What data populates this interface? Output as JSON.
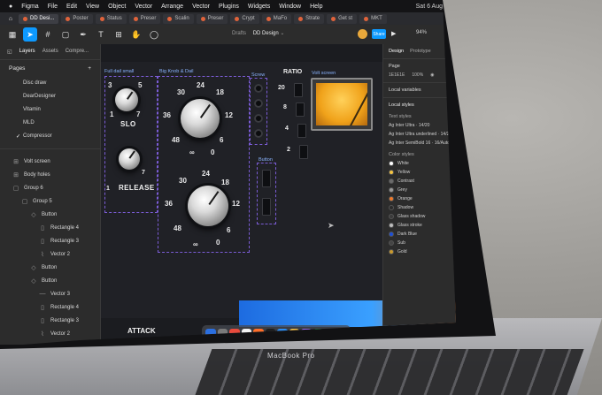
{
  "mac_menu": {
    "items": [
      "Figma",
      "File",
      "Edit",
      "View",
      "Object",
      "Vector",
      "Arrange",
      "Vector",
      "Plugins",
      "Widgets",
      "Window",
      "Help"
    ],
    "status": "Sat 6 Aug"
  },
  "tabs": [
    {
      "label": "DD Desi...",
      "active": true
    },
    {
      "label": "Poster",
      "active": false
    },
    {
      "label": "Status",
      "active": false
    },
    {
      "label": "Preser",
      "active": false
    },
    {
      "label": "Scalin",
      "active": false
    },
    {
      "label": "Preser",
      "active": false
    },
    {
      "label": "Crypt",
      "active": false
    },
    {
      "label": "MaFo",
      "active": false
    },
    {
      "label": "Strate",
      "active": false
    },
    {
      "label": "Get st",
      "active": false
    },
    {
      "label": "MKT",
      "active": false
    }
  ],
  "toolbar": {
    "breadcrumb_prefix": "Drafts",
    "file_name": "DD Design",
    "share_label": "Share",
    "zoom": "94%"
  },
  "left_panel": {
    "tabs": [
      "Layers",
      "Assets",
      "Compre..."
    ],
    "pages_header": "Pages",
    "add_label": "+",
    "pages": [
      {
        "label": "Disc draw",
        "current": false
      },
      {
        "label": "DearDesigner",
        "current": false
      },
      {
        "label": "Vitamin",
        "current": false
      },
      {
        "label": "MLD",
        "current": false
      },
      {
        "label": "Compressor",
        "current": true
      }
    ],
    "layers": [
      {
        "label": "Volt screen",
        "glyph": "⊞",
        "indent": 0
      },
      {
        "label": "Body holes",
        "glyph": "⊞",
        "indent": 0
      },
      {
        "label": "Group 6",
        "glyph": "▢",
        "indent": 0
      },
      {
        "label": "Group 5",
        "glyph": "▢",
        "indent": 1
      },
      {
        "label": "Button",
        "glyph": "◇",
        "indent": 2
      },
      {
        "label": "Rectangle 4",
        "glyph": "▯",
        "indent": 3
      },
      {
        "label": "Rectangle 3",
        "glyph": "▯",
        "indent": 3
      },
      {
        "label": "Vector 2",
        "glyph": "⌇",
        "indent": 3
      },
      {
        "label": "Button",
        "glyph": "◇",
        "indent": 2
      },
      {
        "label": "Button",
        "glyph": "◇",
        "indent": 2
      },
      {
        "label": "Vector 3",
        "glyph": "—",
        "indent": 3
      },
      {
        "label": "Rectangle 4",
        "glyph": "▯",
        "indent": 3
      },
      {
        "label": "Rectangle 3",
        "glyph": "▯",
        "indent": 3
      },
      {
        "label": "Vector 2",
        "glyph": "⌇",
        "indent": 3
      },
      {
        "label": "Button",
        "glyph": "◇",
        "indent": 2
      }
    ]
  },
  "canvas": {
    "frame_labels": {
      "full_dial_small": "Full dail small",
      "big_knob": "Big Knob & Dail",
      "screw": "Screw",
      "volt_screen": "Volt screen",
      "button": "Button"
    },
    "slo": {
      "label": "SLO",
      "ticks": [
        "3",
        "5",
        "1",
        "7"
      ]
    },
    "release": {
      "label": "RELEASE",
      "ticks": [
        "3",
        "5",
        "1",
        "7"
      ]
    },
    "big_knob_1": {
      "ticks": [
        "30",
        "24",
        "18",
        "12",
        "36",
        "48",
        "6",
        "0",
        "∞"
      ]
    },
    "big_knob_2": {
      "ticks": [
        "30",
        "24",
        "18",
        "12",
        "36",
        "48",
        "6",
        "0",
        "∞"
      ]
    },
    "ratio": {
      "title": "RATIO",
      "values": [
        "20",
        "8",
        "4",
        "2"
      ]
    },
    "attack_label": "ATTACK"
  },
  "right_panel": {
    "tabs": [
      "Design",
      "Prototype"
    ],
    "page_label": "Page",
    "page_color": "1E1E1E",
    "page_opacity": "100%",
    "local_variables": "Local variables",
    "local_styles": "Local styles",
    "text_styles_header": "Text styles",
    "text_styles": [
      "Ag  Inter Ultra · 14/20",
      "Ag  Inter Ultra underlined · 14/20",
      "Ag  Inter SemiBold 16 · 16/Auto"
    ],
    "color_styles_header": "Color styles",
    "color_styles": [
      {
        "name": "White",
        "color": "#ffffff"
      },
      {
        "name": "Yellow",
        "color": "#f5c542"
      },
      {
        "name": "Contrast",
        "color": "#6b6b6b"
      },
      {
        "name": "Grey",
        "color": "#9a9a9a"
      },
      {
        "name": "Orange",
        "color": "#f07a2a"
      },
      {
        "name": "Shadow",
        "color": "#2a2a2a"
      },
      {
        "name": "Glass shadow",
        "color": "#3a3a3a"
      },
      {
        "name": "Glass stroke",
        "color": "#bdbdbd"
      },
      {
        "name": "Dark Blue",
        "color": "#1d4fd6"
      },
      {
        "name": "Sub",
        "color": "#444444"
      },
      {
        "name": "Gold",
        "color": "#c99a2e"
      }
    ]
  },
  "hardware": {
    "brand": "MacBook Pro"
  },
  "colors": {
    "accent": "#0d99ff",
    "frame": "#7b5cd6",
    "canvas": "#1b1c20"
  }
}
